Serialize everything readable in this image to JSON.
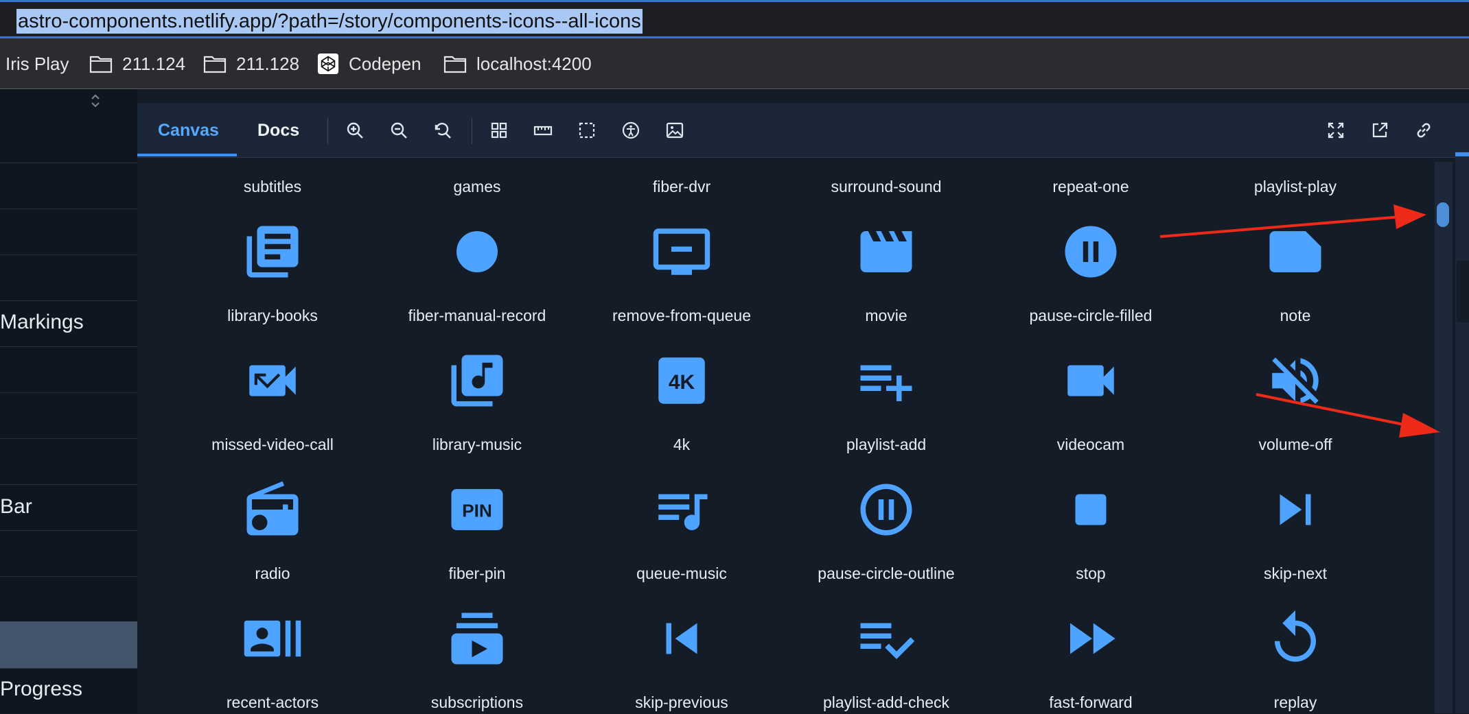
{
  "browser": {
    "url": "astro-components.netlify.app/?path=/story/components-icons--all-icons",
    "bookmarks": [
      {
        "label": "Iris Play",
        "icon": "none"
      },
      {
        "label": "211.124",
        "icon": "folder-icon"
      },
      {
        "label": "211.128",
        "icon": "folder-icon"
      },
      {
        "label": "Codepen",
        "icon": "codepen-icon"
      },
      {
        "label": "localhost:4200",
        "icon": "folder-icon"
      }
    ]
  },
  "sidebar": {
    "items": [
      {
        "label": ""
      },
      {
        "label": ""
      },
      {
        "label": "Markings"
      },
      {
        "label": ""
      },
      {
        "label": ""
      },
      {
        "label": "Bar"
      },
      {
        "label": ""
      },
      {
        "label": ""
      },
      {
        "label": "Progress"
      }
    ]
  },
  "toolbar": {
    "tabs": {
      "canvas": "Canvas",
      "docs": "Docs"
    },
    "icons": [
      "zoom-in-icon",
      "zoom-out-icon",
      "reset-zoom-icon",
      "grid-icon",
      "ruler-icon",
      "outline-icon",
      "accessibility-icon",
      "background-image-icon",
      "fullscreen-icon",
      "open-new-tab-icon",
      "copy-link-icon"
    ]
  },
  "grid": {
    "header_labels": [
      "subtitles",
      "games",
      "fiber-dvr",
      "surround-sound",
      "repeat-one",
      "playlist-play"
    ],
    "rows": [
      [
        "library-books",
        "fiber-manual-record",
        "remove-from-queue",
        "movie",
        "pause-circle-filled",
        "note"
      ],
      [
        "missed-video-call",
        "library-music",
        "4k",
        "playlist-add",
        "videocam",
        "volume-off"
      ],
      [
        "radio",
        "fiber-pin",
        "queue-music",
        "pause-circle-outline",
        "stop",
        "skip-next"
      ],
      [
        "recent-actors",
        "subscriptions",
        "skip-previous",
        "playlist-add-check",
        "fast-forward",
        "replay"
      ]
    ],
    "icon_glyph_text": {
      "4k": "4K",
      "fiber-pin": "PIN"
    }
  },
  "colors": {
    "accent": "#55a8ff",
    "icon": "#4da3ff",
    "annotation": "#ee2a18",
    "background": "#141c28"
  }
}
